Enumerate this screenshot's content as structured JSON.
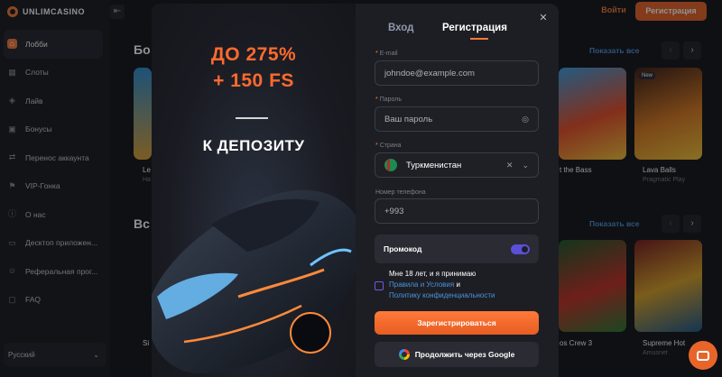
{
  "brand": {
    "name": "UNLIMCASINO"
  },
  "header": {
    "login_label": "Войти",
    "register_label": "Регистрация"
  },
  "sidebar": {
    "items": [
      {
        "label": "Лобби",
        "icon": "home-icon",
        "active": true
      },
      {
        "label": "Слоты",
        "icon": "slots-icon"
      },
      {
        "label": "Лайв",
        "icon": "live-icon"
      },
      {
        "label": "Бонусы",
        "icon": "gift-icon"
      },
      {
        "label": "Перенос аккаунта",
        "icon": "transfer-icon"
      },
      {
        "label": "VIP-Гонка",
        "icon": "vip-icon"
      },
      {
        "label": "О нас",
        "icon": "info-icon"
      },
      {
        "label": "Десктоп приложен...",
        "icon": "desktop-icon"
      },
      {
        "label": "Реферальная прог...",
        "icon": "referral-icon"
      },
      {
        "label": "FAQ",
        "icon": "faq-icon"
      }
    ],
    "language": "Русский"
  },
  "sections": [
    {
      "title": "Бо",
      "show_all": "Показать все"
    },
    {
      "title": "Вс",
      "show_all": "Показать все"
    }
  ],
  "games_row1": [
    {
      "title": "Le",
      "provider": "Ha"
    },
    {
      "title": "t the Bass",
      "provider": ""
    },
    {
      "title": "Lava Balls",
      "provider": "Pragmatic Play",
      "badge": "New"
    }
  ],
  "games_row2": [
    {
      "title": "Si",
      "provider": ""
    },
    {
      "title": "os Crew 3",
      "provider": ""
    },
    {
      "title": "Supreme Hot",
      "provider": "Amusnet"
    }
  ],
  "modal": {
    "promo": {
      "line1": "ДО 275%",
      "line2": "+ 150 FS",
      "line3": "К ДЕПОЗИТУ"
    },
    "tabs": {
      "login": "Вход",
      "register": "Регистрация"
    },
    "fields": {
      "email_label": "E-mail",
      "email_placeholder": "johndoe@example.com",
      "password_label": "Пароль",
      "password_placeholder": "Ваш пароль",
      "country_label": "Страна",
      "country_value": "Туркменистан",
      "phone_label": "Номер телефона",
      "phone_value": "+993"
    },
    "promocode_label": "Промокод",
    "promocode_enabled": true,
    "agreement": {
      "prefix": "Мне 18 лет, и я принимаю",
      "terms_link": "Правила и Условия",
      "and": "и",
      "privacy_link": "Политику конфиденциальности"
    },
    "submit_label": "Зарегистрироваться",
    "google_label": "Продолжить через Google"
  },
  "colors": {
    "accent": "#e8652a",
    "link": "#4a93d9",
    "toggle": "#5b4fd8",
    "background": "#15161b"
  }
}
